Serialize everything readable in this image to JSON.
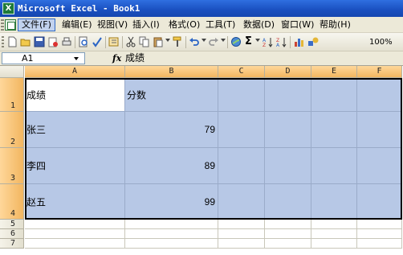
{
  "window": {
    "title": "Microsoft Excel - Book1",
    "logo_letter": "X"
  },
  "menu": [
    {
      "label": "文件(F)",
      "active": true
    },
    {
      "label": "编辑(E)"
    },
    {
      "label": "视图(V)"
    },
    {
      "label": "插入(I)"
    },
    {
      "label": "格式(O)"
    },
    {
      "label": "工具(T)"
    },
    {
      "label": "数据(D)"
    },
    {
      "label": "窗口(W)"
    },
    {
      "label": "帮助(H)"
    }
  ],
  "toolbar": {
    "zoom": "100%",
    "icons": [
      "new-icon",
      "open-icon",
      "save-icon",
      "permission-icon",
      "print-icon",
      "print-preview-icon",
      "spelling-icon",
      "research-icon",
      "cut-icon",
      "copy-icon",
      "paste-icon",
      "format-painter-icon",
      "undo-icon",
      "redo-icon",
      "hyperlink-icon",
      "autosum-icon",
      "sort-ascending-icon",
      "sort-descending-icon",
      "chart-wizard-icon",
      "drawing-icon"
    ]
  },
  "formula_bar": {
    "name_box": "A1",
    "fx": "fx",
    "value": "成绩"
  },
  "columns": [
    "A",
    "B",
    "C",
    "D",
    "E",
    "F"
  ],
  "rows": [
    {
      "num": "1",
      "cells": [
        "成绩",
        "分数",
        "",
        "",
        "",
        ""
      ]
    },
    {
      "num": "2",
      "cells": [
        "张三",
        "79",
        "",
        "",
        "",
        ""
      ]
    },
    {
      "num": "3",
      "cells": [
        "李四",
        "89",
        "",
        "",
        "",
        ""
      ]
    },
    {
      "num": "4",
      "cells": [
        "赵五",
        "99",
        "",
        "",
        "",
        ""
      ]
    },
    {
      "num": "5",
      "cells": [
        "",
        "",
        "",
        "",
        "",
        ""
      ]
    },
    {
      "num": "6",
      "cells": [
        "",
        "",
        "",
        "",
        "",
        ""
      ]
    },
    {
      "num": "7",
      "cells": [
        "",
        "",
        "",
        "",
        "",
        ""
      ]
    }
  ],
  "colors": {
    "title_bar": "#1a4fbf",
    "selection": "#b7c8e6",
    "header_highlight": "#f2b660"
  }
}
